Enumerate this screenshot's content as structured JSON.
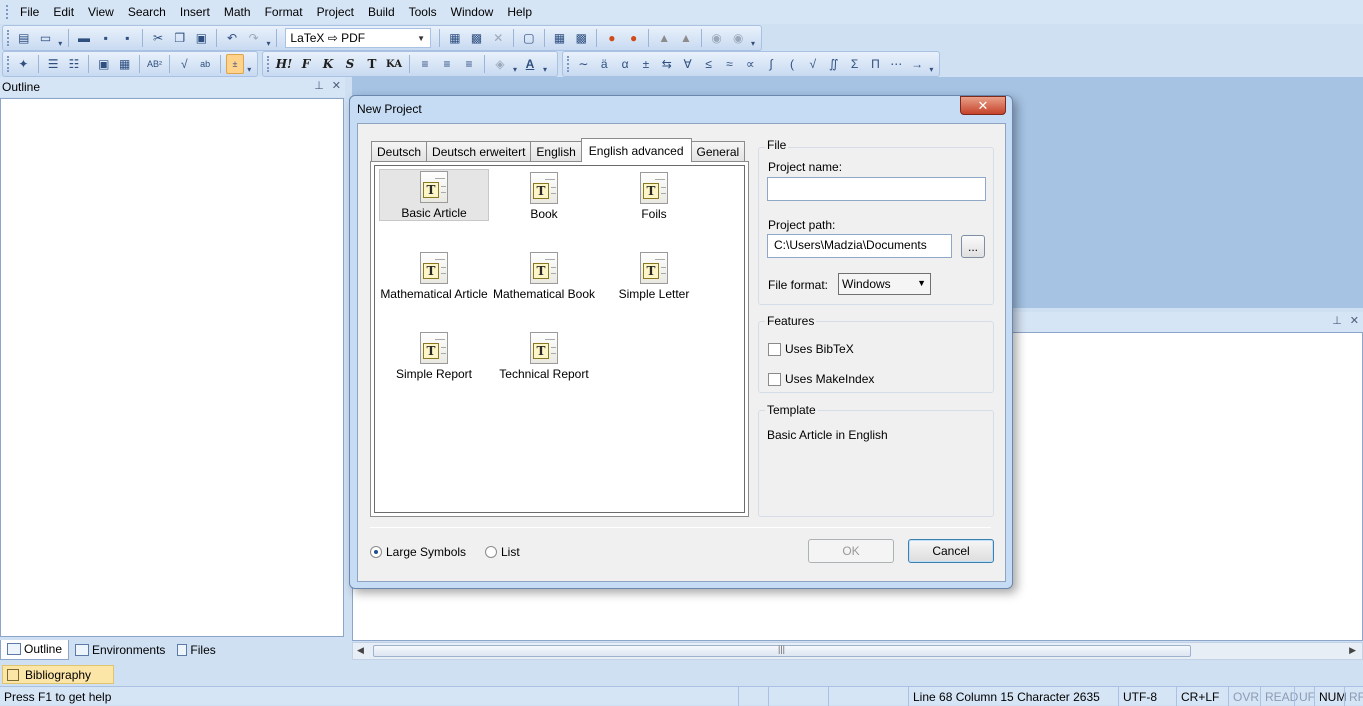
{
  "menu": [
    "File",
    "Edit",
    "View",
    "Search",
    "Insert",
    "Math",
    "Format",
    "Project",
    "Build",
    "Tools",
    "Window",
    "Help"
  ],
  "toolbar": {
    "output_profile": "LaTeX ⇨ PDF",
    "format_buttons": [
      "H!",
      "F",
      "K",
      "S",
      "T",
      "KA"
    ]
  },
  "left_pane": {
    "title": "Outline",
    "tabs": [
      "Outline",
      "Environments",
      "Files"
    ],
    "bibliography_label": "Bibliography"
  },
  "dialog": {
    "title": "New Project",
    "close": "✕",
    "tabs": [
      "Deutsch",
      "Deutsch erweitert",
      "English",
      "English advanced",
      "General"
    ],
    "selected_tab": "English advanced",
    "templates": [
      "Basic Article",
      "Book",
      "Foils",
      "Mathematical Article",
      "Mathematical Book",
      "Simple Letter",
      "Simple Report",
      "Technical Report"
    ],
    "selected_template": "Basic Article",
    "file_group": {
      "label": "File",
      "project_name_label": "Project name:",
      "project_name_value": "",
      "project_path_label": "Project path:",
      "project_path_value": "C:\\Users\\Madzia\\Documents",
      "browse_label": "...",
      "file_format_label": "File format:",
      "file_format_value": "Windows"
    },
    "features_group": {
      "label": "Features",
      "uses_bibtex": "Uses BibTeX",
      "uses_makeindex": "Uses MakeIndex"
    },
    "template_group": {
      "label": "Template",
      "description": "Basic Article in English"
    },
    "view_mode": {
      "large_symbols": "Large Symbols",
      "list": "List",
      "selected": "Large Symbols"
    },
    "ok_label": "OK",
    "cancel_label": "Cancel"
  },
  "statusbar": {
    "help": "Press F1 to get help",
    "position": "Line 68 Column 15 Character 2635",
    "encoding": "UTF-8",
    "line_ending": "CR+LF",
    "indicators": [
      "OVR",
      "READ",
      "UF",
      "NUM",
      "RF"
    ]
  }
}
